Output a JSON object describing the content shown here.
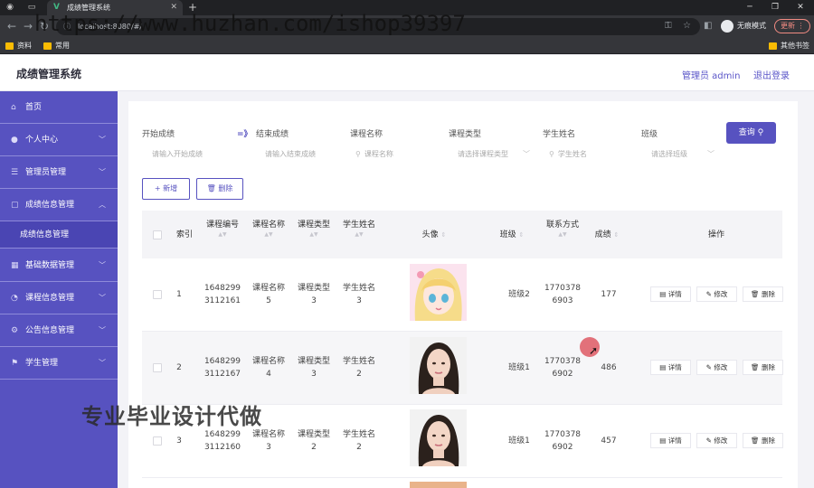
{
  "browser": {
    "tab_title": "成绩管理系统",
    "url": "localhost:8080/#/",
    "incognito_label": "无痕模式",
    "update_label": "更新",
    "bookmarks": [
      "资料",
      "常用",
      "其他书签"
    ]
  },
  "overlay": {
    "url_watermark": "https://www.huzhan.com/ishop39397",
    "promo_text": "专业毕业设计代做"
  },
  "header": {
    "title": "成绩管理系统",
    "admin": "管理员 admin",
    "logout": "退出登录"
  },
  "sidebar": {
    "items": [
      {
        "label": "首页",
        "icon": "home-icon"
      },
      {
        "label": "个人中心",
        "icon": "user-icon"
      },
      {
        "label": "管理员管理",
        "icon": "list-icon"
      },
      {
        "label": "成绩信息管理",
        "icon": "doc-icon"
      },
      {
        "label": "基础数据管理",
        "icon": "grid-icon"
      },
      {
        "label": "课程信息管理",
        "icon": "clock-icon"
      },
      {
        "label": "公告信息管理",
        "icon": "settings-icon"
      },
      {
        "label": "学生管理",
        "icon": "student-icon"
      }
    ],
    "sub_item": "成绩信息管理"
  },
  "filters": {
    "start_label": "开始成绩",
    "start_placeholder": "请输入开始成绩",
    "end_label": "结束成绩",
    "end_placeholder": "请输入结束成绩",
    "course_label": "课程名称",
    "course_placeholder": "课程名称",
    "type_label": "课程类型",
    "type_placeholder": "请选择课程类型",
    "student_label": "学生姓名",
    "student_placeholder": "学生姓名",
    "class_label": "班级",
    "class_placeholder": "请选择班级",
    "query": "查询"
  },
  "actions": {
    "add": "+ 新增",
    "delete": "删除"
  },
  "table": {
    "headers": {
      "index": "索引",
      "course_id": "课程编号",
      "course_name": "课程名称",
      "course_type": "课程类型",
      "student": "学生姓名",
      "avatar": "头像",
      "class": "班级",
      "contact": "联系方式",
      "score": "成绩",
      "ops": "操作"
    },
    "rows": [
      {
        "index": "1",
        "id1": "1648299",
        "id2": "3112161",
        "cname1": "课程名称",
        "cname2": "5",
        "ctype1": "课程类型",
        "ctype2": "3",
        "sname1": "学生姓名",
        "sname2": "3",
        "class": "班级2",
        "phone1": "1770378",
        "phone2": "6903",
        "score": "177",
        "avatar": "anime-girl"
      },
      {
        "index": "2",
        "id1": "1648299",
        "id2": "3112167",
        "cname1": "课程名称",
        "cname2": "4",
        "ctype1": "课程类型",
        "ctype2": "3",
        "sname1": "学生姓名",
        "sname2": "2",
        "class": "班级1",
        "phone1": "1770378",
        "phone2": "6902",
        "score": "486",
        "avatar": "woman-portrait"
      },
      {
        "index": "3",
        "id1": "1648299",
        "id2": "3112160",
        "cname1": "课程名称",
        "cname2": "3",
        "ctype1": "课程类型",
        "ctype2": "2",
        "sname1": "学生姓名",
        "sname2": "2",
        "class": "班级1",
        "phone1": "1770378",
        "phone2": "6902",
        "score": "457",
        "avatar": "woman-portrait"
      }
    ],
    "op_labels": {
      "detail": "详情",
      "edit": "修改",
      "delete": "删除"
    }
  },
  "colors": {
    "accent": "#5752c0",
    "sidebar": "#5752c0"
  }
}
